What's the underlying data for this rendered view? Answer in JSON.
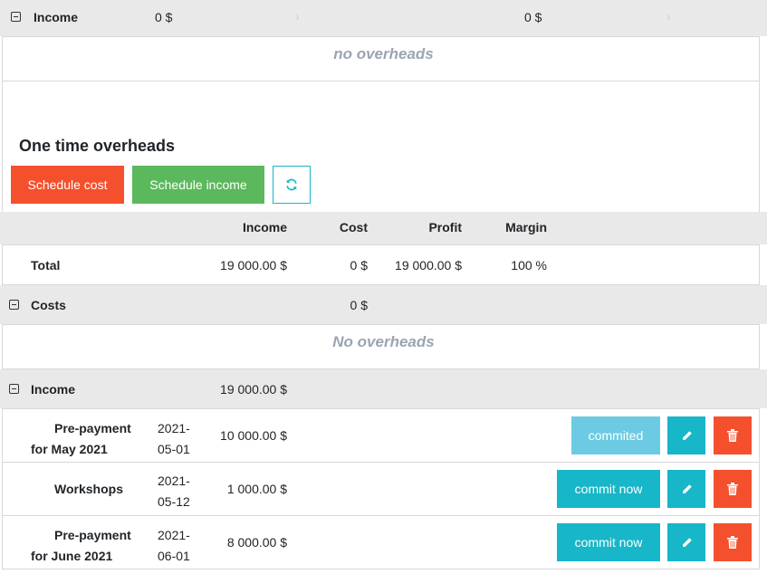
{
  "top_income": {
    "label": "Income",
    "value1": "0 $",
    "value2": "0 $"
  },
  "no_overheads_top": "no overheads",
  "one_time": {
    "title": "One time overheads",
    "schedule_cost": "Schedule cost",
    "schedule_income": "Schedule income"
  },
  "table_header": {
    "income": "Income",
    "cost": "Cost",
    "profit": "Profit",
    "margin": "Margin"
  },
  "total": {
    "label": "Total",
    "income": "19 000.00 $",
    "cost": "0 $",
    "profit": "19 000.00 $",
    "margin": "100 %"
  },
  "costs": {
    "label": "Costs",
    "value": "0 $"
  },
  "no_overheads_costs": "No overheads",
  "income_group": {
    "label": "Income",
    "value": "19 000.00 $"
  },
  "income_rows": [
    {
      "name_line1": "Pre-payment",
      "name_line2": "for May 2021",
      "date_line1": "2021-",
      "date_line2": "05-01",
      "amount": "10 000.00 $",
      "status": "commited"
    },
    {
      "name_line1": "Workshops",
      "name_line2": "",
      "date_line1": "2021-",
      "date_line2": "05-12",
      "amount": "1 000.00 $",
      "status": "commit now"
    },
    {
      "name_line1": "Pre-payment",
      "name_line2": "for June 2021",
      "date_line1": "2021-",
      "date_line2": "06-01",
      "amount": "8 000.00 $",
      "status": "commit now"
    }
  ],
  "colors": {
    "red": "#f4502d",
    "green": "#5cb85c",
    "teal": "#17b6c8",
    "light_teal": "#6ccbe3"
  }
}
